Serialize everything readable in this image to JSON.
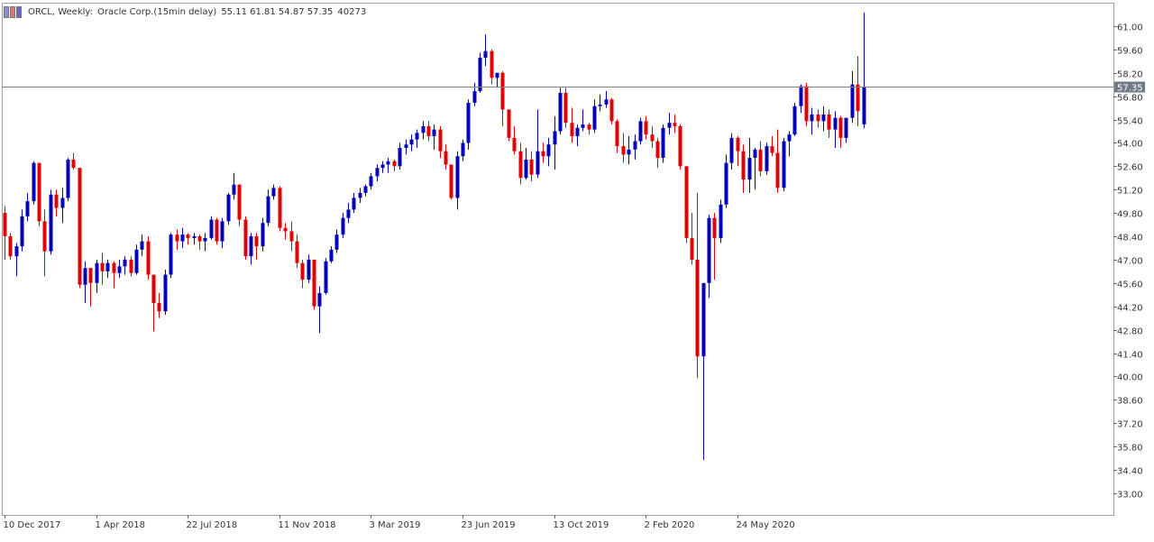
{
  "header": {
    "symbol": "ORCL, Weekly:",
    "description": "Oracle Corp.(15min delay)",
    "ohlc": "55.11 61.81 54.87 57.35",
    "volume": "40273"
  },
  "colors": {
    "bull": "#0000b8",
    "bear": "#e00000",
    "grid_border": "#a0a0a0",
    "price_line": "#808080",
    "price_tag_bg": "#6f7a86",
    "price_tag_text": "#ffffff"
  },
  "chart_data": {
    "type": "candlestick",
    "y_ticks": [
      "61.00",
      "59.60",
      "58.20",
      "56.80",
      "55.40",
      "54.00",
      "52.60",
      "51.20",
      "49.80",
      "48.40",
      "47.00",
      "45.60",
      "44.20",
      "42.80",
      "41.40",
      "40.00",
      "38.60",
      "37.20",
      "35.80",
      "34.40",
      "33.00"
    ],
    "y_tick_values": [
      61.0,
      59.6,
      58.2,
      56.8,
      55.4,
      54.0,
      52.6,
      51.2,
      49.8,
      48.4,
      47.0,
      45.6,
      44.2,
      42.8,
      41.4,
      40.0,
      38.6,
      37.2,
      35.8,
      34.4,
      33.0
    ],
    "ylim": [
      31.7,
      62.4
    ],
    "x_labels": [
      "10 Dec 2017",
      "1 Apr 2018",
      "22 Jul 2018",
      "11 Nov 2018",
      "3 Mar 2019",
      "23 Jun 2019",
      "13 Oct 2019",
      "2 Feb 2020",
      "24 May 2020"
    ],
    "x_label_bar_index": [
      0,
      16,
      32,
      48,
      64,
      80,
      96,
      112,
      128
    ],
    "current_price": "57.35",
    "candles": [
      {
        "o": 49.8,
        "h": 50.2,
        "l": 47.0,
        "c": 48.4
      },
      {
        "o": 48.4,
        "h": 48.6,
        "l": 47.0,
        "c": 47.2
      },
      {
        "o": 47.2,
        "h": 48.0,
        "l": 46.0,
        "c": 47.8
      },
      {
        "o": 47.8,
        "h": 50.0,
        "l": 47.5,
        "c": 49.6
      },
      {
        "o": 49.6,
        "h": 51.0,
        "l": 49.3,
        "c": 50.5
      },
      {
        "o": 50.5,
        "h": 52.9,
        "l": 50.3,
        "c": 52.8
      },
      {
        "o": 52.8,
        "h": 52.8,
        "l": 49.0,
        "c": 49.3
      },
      {
        "o": 49.3,
        "h": 50.0,
        "l": 46.0,
        "c": 47.5
      },
      {
        "o": 47.5,
        "h": 51.2,
        "l": 47.3,
        "c": 50.9
      },
      {
        "o": 50.9,
        "h": 51.2,
        "l": 49.6,
        "c": 50.1
      },
      {
        "o": 50.1,
        "h": 51.3,
        "l": 49.2,
        "c": 50.7
      },
      {
        "o": 50.7,
        "h": 53.1,
        "l": 50.5,
        "c": 53.0
      },
      {
        "o": 53.0,
        "h": 53.4,
        "l": 52.4,
        "c": 52.5
      },
      {
        "o": 52.5,
        "h": 52.5,
        "l": 45.3,
        "c": 45.5
      },
      {
        "o": 45.5,
        "h": 46.9,
        "l": 44.4,
        "c": 46.5
      },
      {
        "o": 46.5,
        "h": 46.5,
        "l": 44.2,
        "c": 45.6
      },
      {
        "o": 45.6,
        "h": 47.0,
        "l": 45.0,
        "c": 46.8
      },
      {
        "o": 46.8,
        "h": 47.4,
        "l": 45.5,
        "c": 46.3
      },
      {
        "o": 46.3,
        "h": 47.0,
        "l": 45.9,
        "c": 46.8
      },
      {
        "o": 46.8,
        "h": 46.9,
        "l": 45.3,
        "c": 46.2
      },
      {
        "o": 46.2,
        "h": 47.0,
        "l": 45.9,
        "c": 46.6
      },
      {
        "o": 46.6,
        "h": 47.2,
        "l": 46.1,
        "c": 47.0
      },
      {
        "o": 47.0,
        "h": 47.2,
        "l": 46.0,
        "c": 46.2
      },
      {
        "o": 46.2,
        "h": 47.9,
        "l": 46.1,
        "c": 47.6
      },
      {
        "o": 47.6,
        "h": 48.5,
        "l": 47.2,
        "c": 48.1
      },
      {
        "o": 48.1,
        "h": 48.4,
        "l": 45.8,
        "c": 46.1
      },
      {
        "o": 46.1,
        "h": 46.1,
        "l": 42.7,
        "c": 44.4
      },
      {
        "o": 44.4,
        "h": 45.0,
        "l": 43.5,
        "c": 43.9
      },
      {
        "o": 43.9,
        "h": 46.4,
        "l": 43.7,
        "c": 46.1
      },
      {
        "o": 46.1,
        "h": 48.6,
        "l": 45.9,
        "c": 48.5
      },
      {
        "o": 48.5,
        "h": 48.8,
        "l": 47.6,
        "c": 48.1
      },
      {
        "o": 48.1,
        "h": 48.9,
        "l": 47.7,
        "c": 48.5
      },
      {
        "o": 48.5,
        "h": 48.6,
        "l": 47.9,
        "c": 48.3
      },
      {
        "o": 48.3,
        "h": 48.6,
        "l": 47.9,
        "c": 48.4
      },
      {
        "o": 48.4,
        "h": 48.5,
        "l": 47.6,
        "c": 48.1
      },
      {
        "o": 48.1,
        "h": 48.6,
        "l": 47.5,
        "c": 48.3
      },
      {
        "o": 48.3,
        "h": 49.6,
        "l": 48.2,
        "c": 49.4
      },
      {
        "o": 49.4,
        "h": 49.5,
        "l": 47.9,
        "c": 48.1
      },
      {
        "o": 48.1,
        "h": 49.5,
        "l": 47.7,
        "c": 49.3
      },
      {
        "o": 49.3,
        "h": 51.0,
        "l": 49.1,
        "c": 50.9
      },
      {
        "o": 50.9,
        "h": 52.2,
        "l": 50.6,
        "c": 51.5
      },
      {
        "o": 51.5,
        "h": 51.5,
        "l": 49.0,
        "c": 49.4
      },
      {
        "o": 49.4,
        "h": 49.6,
        "l": 47.0,
        "c": 47.2
      },
      {
        "o": 47.2,
        "h": 48.6,
        "l": 46.7,
        "c": 48.4
      },
      {
        "o": 48.4,
        "h": 48.6,
        "l": 47.0,
        "c": 47.8
      },
      {
        "o": 47.8,
        "h": 49.5,
        "l": 47.5,
        "c": 49.2
      },
      {
        "o": 49.2,
        "h": 51.2,
        "l": 49.0,
        "c": 50.8
      },
      {
        "o": 50.8,
        "h": 51.5,
        "l": 50.6,
        "c": 51.3
      },
      {
        "o": 51.3,
        "h": 51.4,
        "l": 48.7,
        "c": 48.9
      },
      {
        "o": 48.9,
        "h": 49.2,
        "l": 48.2,
        "c": 48.7
      },
      {
        "o": 48.7,
        "h": 49.3,
        "l": 47.5,
        "c": 48.1
      },
      {
        "o": 48.1,
        "h": 48.5,
        "l": 46.5,
        "c": 46.8
      },
      {
        "o": 46.8,
        "h": 47.0,
        "l": 45.3,
        "c": 45.8
      },
      {
        "o": 45.8,
        "h": 47.3,
        "l": 45.6,
        "c": 47.0
      },
      {
        "o": 47.0,
        "h": 47.0,
        "l": 44.0,
        "c": 44.2
      },
      {
        "o": 44.2,
        "h": 45.4,
        "l": 42.6,
        "c": 45.0
      },
      {
        "o": 45.0,
        "h": 47.1,
        "l": 44.9,
        "c": 46.9
      },
      {
        "o": 46.9,
        "h": 47.8,
        "l": 46.8,
        "c": 47.6
      },
      {
        "o": 47.6,
        "h": 48.8,
        "l": 47.4,
        "c": 48.5
      },
      {
        "o": 48.5,
        "h": 49.8,
        "l": 48.3,
        "c": 49.5
      },
      {
        "o": 49.5,
        "h": 50.4,
        "l": 49.2,
        "c": 50.0
      },
      {
        "o": 50.0,
        "h": 51.0,
        "l": 49.8,
        "c": 50.7
      },
      {
        "o": 50.7,
        "h": 51.3,
        "l": 50.4,
        "c": 51.0
      },
      {
        "o": 51.0,
        "h": 51.5,
        "l": 50.8,
        "c": 51.4
      },
      {
        "o": 51.4,
        "h": 52.2,
        "l": 51.2,
        "c": 52.0
      },
      {
        "o": 52.0,
        "h": 52.7,
        "l": 51.7,
        "c": 52.5
      },
      {
        "o": 52.5,
        "h": 52.9,
        "l": 52.2,
        "c": 52.7
      },
      {
        "o": 52.7,
        "h": 53.1,
        "l": 52.2,
        "c": 52.9
      },
      {
        "o": 52.9,
        "h": 53.0,
        "l": 52.3,
        "c": 52.6
      },
      {
        "o": 52.6,
        "h": 54.0,
        "l": 52.4,
        "c": 53.7
      },
      {
        "o": 53.7,
        "h": 54.2,
        "l": 53.3,
        "c": 53.9
      },
      {
        "o": 53.9,
        "h": 54.5,
        "l": 53.5,
        "c": 54.2
      },
      {
        "o": 54.2,
        "h": 54.8,
        "l": 53.7,
        "c": 54.6
      },
      {
        "o": 54.6,
        "h": 55.3,
        "l": 54.2,
        "c": 55.0
      },
      {
        "o": 55.0,
        "h": 55.3,
        "l": 54.1,
        "c": 54.4
      },
      {
        "o": 54.4,
        "h": 55.1,
        "l": 53.6,
        "c": 54.8
      },
      {
        "o": 54.8,
        "h": 55.0,
        "l": 53.1,
        "c": 53.5
      },
      {
        "o": 53.5,
        "h": 53.9,
        "l": 52.4,
        "c": 52.7
      },
      {
        "o": 52.7,
        "h": 52.7,
        "l": 50.6,
        "c": 50.7
      },
      {
        "o": 50.7,
        "h": 53.5,
        "l": 50.0,
        "c": 53.2
      },
      {
        "o": 53.2,
        "h": 54.2,
        "l": 52.9,
        "c": 54.0
      },
      {
        "o": 54.0,
        "h": 56.6,
        "l": 53.6,
        "c": 56.4
      },
      {
        "o": 56.4,
        "h": 57.6,
        "l": 56.2,
        "c": 57.1
      },
      {
        "o": 57.1,
        "h": 59.4,
        "l": 57.0,
        "c": 59.1
      },
      {
        "o": 59.1,
        "h": 60.5,
        "l": 58.6,
        "c": 59.5
      },
      {
        "o": 59.5,
        "h": 59.6,
        "l": 57.5,
        "c": 57.9
      },
      {
        "o": 57.9,
        "h": 58.0,
        "l": 57.3,
        "c": 58.2
      },
      {
        "o": 58.2,
        "h": 58.3,
        "l": 55.0,
        "c": 56.0
      },
      {
        "o": 56.0,
        "h": 56.0,
        "l": 54.1,
        "c": 54.3
      },
      {
        "o": 54.3,
        "h": 55.0,
        "l": 53.3,
        "c": 53.5
      },
      {
        "o": 53.5,
        "h": 54.0,
        "l": 51.5,
        "c": 51.9
      },
      {
        "o": 51.9,
        "h": 53.7,
        "l": 51.8,
        "c": 53.0
      },
      {
        "o": 53.0,
        "h": 53.5,
        "l": 51.7,
        "c": 52.1
      },
      {
        "o": 52.1,
        "h": 56.0,
        "l": 51.9,
        "c": 53.5
      },
      {
        "o": 53.5,
        "h": 54.0,
        "l": 52.8,
        "c": 53.2
      },
      {
        "o": 53.2,
        "h": 54.3,
        "l": 52.6,
        "c": 53.9
      },
      {
        "o": 53.9,
        "h": 55.6,
        "l": 52.4,
        "c": 54.7
      },
      {
        "o": 54.7,
        "h": 57.3,
        "l": 54.5,
        "c": 57.0
      },
      {
        "o": 57.0,
        "h": 57.3,
        "l": 54.9,
        "c": 55.2
      },
      {
        "o": 55.2,
        "h": 56.1,
        "l": 54.0,
        "c": 54.4
      },
      {
        "o": 54.4,
        "h": 55.1,
        "l": 53.8,
        "c": 54.9
      },
      {
        "o": 54.9,
        "h": 56.0,
        "l": 54.7,
        "c": 55.1
      },
      {
        "o": 55.1,
        "h": 55.2,
        "l": 54.5,
        "c": 54.8
      },
      {
        "o": 54.8,
        "h": 56.6,
        "l": 54.6,
        "c": 56.2
      },
      {
        "o": 56.2,
        "h": 56.9,
        "l": 55.9,
        "c": 56.3
      },
      {
        "o": 56.3,
        "h": 57.1,
        "l": 56.1,
        "c": 56.6
      },
      {
        "o": 56.6,
        "h": 56.7,
        "l": 55.1,
        "c": 55.3
      },
      {
        "o": 55.3,
        "h": 55.4,
        "l": 53.4,
        "c": 53.8
      },
      {
        "o": 53.8,
        "h": 54.6,
        "l": 52.8,
        "c": 53.3
      },
      {
        "o": 53.3,
        "h": 54.4,
        "l": 52.7,
        "c": 53.6
      },
      {
        "o": 53.6,
        "h": 54.5,
        "l": 53.0,
        "c": 54.1
      },
      {
        "o": 54.1,
        "h": 55.5,
        "l": 53.9,
        "c": 55.3
      },
      {
        "o": 55.3,
        "h": 55.6,
        "l": 54.2,
        "c": 54.5
      },
      {
        "o": 54.5,
        "h": 55.0,
        "l": 53.7,
        "c": 54.1
      },
      {
        "o": 54.1,
        "h": 54.3,
        "l": 52.5,
        "c": 53.1
      },
      {
        "o": 53.1,
        "h": 55.1,
        "l": 52.8,
        "c": 54.9
      },
      {
        "o": 54.9,
        "h": 55.8,
        "l": 54.5,
        "c": 55.2
      },
      {
        "o": 55.2,
        "h": 55.7,
        "l": 54.6,
        "c": 55.0
      },
      {
        "o": 55.0,
        "h": 55.1,
        "l": 52.4,
        "c": 52.6
      },
      {
        "o": 52.6,
        "h": 52.6,
        "l": 48.0,
        "c": 48.3
      },
      {
        "o": 48.3,
        "h": 49.8,
        "l": 46.7,
        "c": 47.0
      },
      {
        "o": 47.0,
        "h": 51.0,
        "l": 39.9,
        "c": 41.2
      },
      {
        "o": 41.2,
        "h": 44.3,
        "l": 35.0,
        "c": 45.6
      },
      {
        "o": 45.6,
        "h": 49.7,
        "l": 44.7,
        "c": 49.5
      },
      {
        "o": 49.5,
        "h": 49.8,
        "l": 45.8,
        "c": 48.3
      },
      {
        "o": 48.3,
        "h": 50.6,
        "l": 48.0,
        "c": 50.3
      },
      {
        "o": 50.3,
        "h": 53.3,
        "l": 50.1,
        "c": 52.8
      },
      {
        "o": 52.8,
        "h": 54.6,
        "l": 52.4,
        "c": 54.3
      },
      {
        "o": 54.3,
        "h": 54.4,
        "l": 52.6,
        "c": 53.5
      },
      {
        "o": 53.5,
        "h": 53.9,
        "l": 51.0,
        "c": 51.8
      },
      {
        "o": 51.8,
        "h": 54.3,
        "l": 51.0,
        "c": 53.1
      },
      {
        "o": 53.1,
        "h": 53.7,
        "l": 51.2,
        "c": 53.6
      },
      {
        "o": 53.6,
        "h": 54.1,
        "l": 52.0,
        "c": 52.3
      },
      {
        "o": 52.3,
        "h": 54.0,
        "l": 52.1,
        "c": 53.8
      },
      {
        "o": 53.8,
        "h": 54.4,
        "l": 53.2,
        "c": 53.4
      },
      {
        "o": 53.4,
        "h": 54.8,
        "l": 51.0,
        "c": 51.3
      },
      {
        "o": 51.3,
        "h": 54.3,
        "l": 51.1,
        "c": 54.1
      },
      {
        "o": 54.1,
        "h": 54.7,
        "l": 53.2,
        "c": 54.5
      },
      {
        "o": 54.5,
        "h": 56.4,
        "l": 54.4,
        "c": 56.2
      },
      {
        "o": 56.2,
        "h": 57.5,
        "l": 55.8,
        "c": 57.4
      },
      {
        "o": 57.4,
        "h": 57.6,
        "l": 55.0,
        "c": 55.3
      },
      {
        "o": 55.3,
        "h": 56.1,
        "l": 54.5,
        "c": 55.7
      },
      {
        "o": 55.7,
        "h": 56.0,
        "l": 54.9,
        "c": 55.3
      },
      {
        "o": 55.3,
        "h": 56.2,
        "l": 54.7,
        "c": 55.7
      },
      {
        "o": 55.7,
        "h": 56.0,
        "l": 54.3,
        "c": 54.8
      },
      {
        "o": 54.8,
        "h": 55.9,
        "l": 53.7,
        "c": 55.5
      },
      {
        "o": 55.5,
        "h": 55.6,
        "l": 53.7,
        "c": 54.3
      },
      {
        "o": 54.3,
        "h": 55.4,
        "l": 54.0,
        "c": 55.5
      },
      {
        "o": 55.5,
        "h": 58.3,
        "l": 55.2,
        "c": 57.5
      },
      {
        "o": 57.5,
        "h": 59.2,
        "l": 55.0,
        "c": 55.9
      },
      {
        "o": 55.11,
        "h": 61.81,
        "l": 54.87,
        "c": 57.35
      }
    ]
  }
}
